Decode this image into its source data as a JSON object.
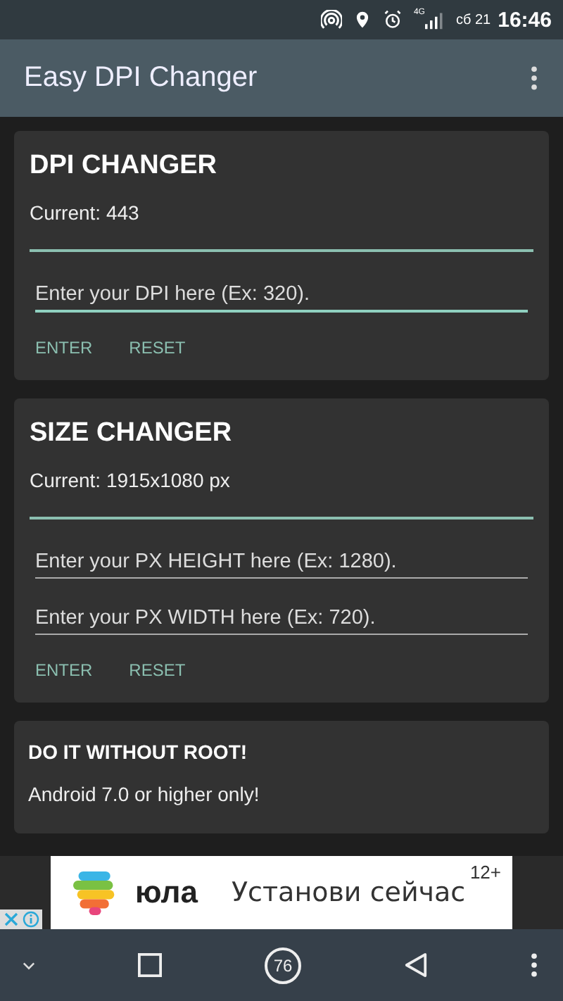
{
  "status_bar": {
    "network": "4G",
    "date": "сб 21",
    "time": "16:46"
  },
  "app_bar": {
    "title": "Easy DPI Changer"
  },
  "cards": [
    {
      "title": "DPI CHANGER",
      "current": "Current: 443",
      "fields": [
        {
          "placeholder": "Enter your DPI here (Ex: 320).",
          "focused": true
        }
      ],
      "buttons": [
        "ENTER",
        "RESET"
      ]
    },
    {
      "title": "SIZE CHANGER",
      "current": "Current: 1915x1080 px",
      "fields": [
        {
          "placeholder": "Enter your PX HEIGHT here (Ex: 1280).",
          "focused": false
        },
        {
          "placeholder": "Enter your PX WIDTH here (Ex: 720).",
          "focused": false
        }
      ],
      "buttons": [
        "ENTER",
        "RESET"
      ]
    }
  ],
  "root_card": {
    "title": "DO IT WITHOUT ROOT!",
    "text": "Android 7.0 or higher only!"
  },
  "ad": {
    "brand": "юла",
    "cta": "Установи сейчас",
    "age": "12+"
  },
  "nav_bar": {
    "badge": "76"
  }
}
